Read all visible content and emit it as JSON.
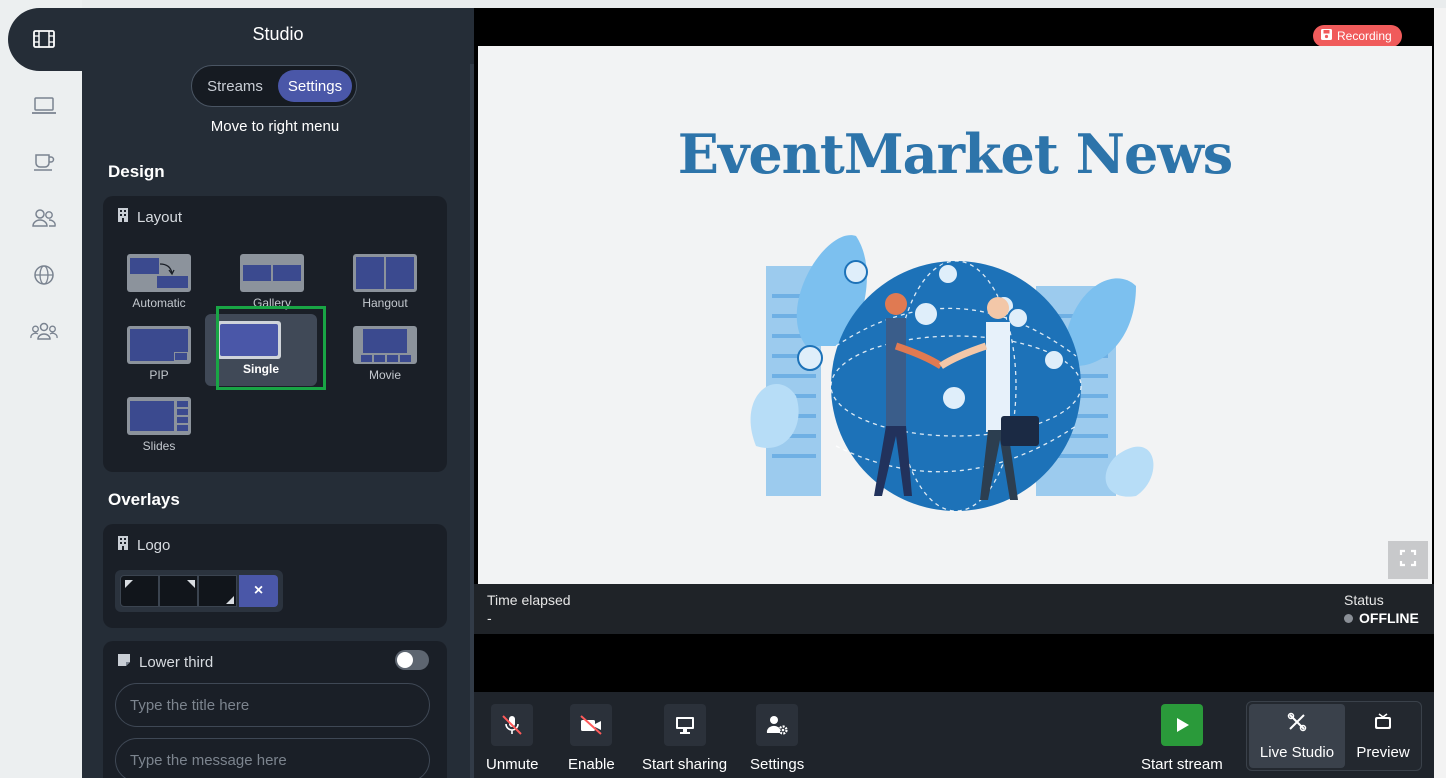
{
  "panel": {
    "title": "Studio",
    "tabs": {
      "streams": "Streams",
      "settings": "Settings"
    },
    "move_to_right_menu": "Move to right menu",
    "design_heading": "Design",
    "layout": {
      "title": "Layout",
      "options": [
        {
          "label": "Automatic"
        },
        {
          "label": "Gallery"
        },
        {
          "label": "Hangout"
        },
        {
          "label": "PIP"
        },
        {
          "label": "Single",
          "selected": true
        },
        {
          "label": "Movie"
        },
        {
          "label": "Slides"
        }
      ]
    },
    "overlays_heading": "Overlays",
    "logo": {
      "title": "Logo",
      "remove": "×"
    },
    "lower_third": {
      "title": "Lower third",
      "enabled": false,
      "title_placeholder": "Type the title here",
      "message_placeholder": "Type the message here"
    }
  },
  "stage": {
    "recording_label": "Recording",
    "headline": "EventMarket News",
    "time_elapsed_label": "Time elapsed",
    "time_elapsed_value": "-",
    "status_label": "Status",
    "status_value": "OFFLINE"
  },
  "controls": {
    "unmute": "Unmute",
    "enable": "Enable",
    "start_sharing": "Start sharing",
    "settings": "Settings",
    "start_stream": "Start stream",
    "live_studio": "Live Studio",
    "preview": "Preview"
  },
  "colors": {
    "accent": "#4a57a8",
    "panel_bg": "#252d37",
    "recording": "#f05b5b",
    "start_stream": "#2a9a3a",
    "selection": "#19a545",
    "headline": "#2d74aa"
  }
}
